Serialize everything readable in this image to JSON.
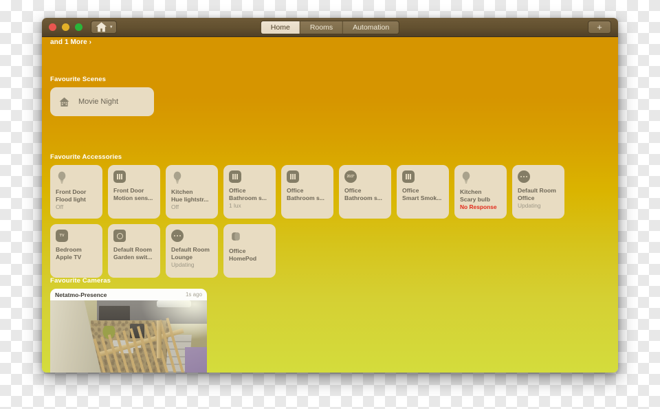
{
  "window": {
    "traffic_lights": [
      "close",
      "minimize",
      "zoom"
    ],
    "home_button_icon": "house-icon",
    "home_button_chevron": "▾",
    "add_button_label": "+"
  },
  "tabs": [
    {
      "label": "Home",
      "active": true
    },
    {
      "label": "Rooms",
      "active": false
    },
    {
      "label": "Automation",
      "active": false
    }
  ],
  "status_link": {
    "label": "and 1 More ›"
  },
  "sections": {
    "scenes": {
      "title": "Favourite Scenes",
      "cards": [
        {
          "icon": "house-icon",
          "label": "Movie Night"
        }
      ]
    },
    "accessories": {
      "title": "Favourite Accessories",
      "cards": [
        {
          "icon": "bulb-icon",
          "name_line1": "Front Door",
          "name_line2": "Flood light",
          "state": "Off",
          "state_kind": "normal"
        },
        {
          "icon": "sensor-icon",
          "name_line1": "Front Door",
          "name_line2": "Motion sens...",
          "state": "",
          "state_kind": "normal"
        },
        {
          "icon": "bulb-icon",
          "name_line1": "Kitchen",
          "name_line2": "Hue lightstr...",
          "state": "Off",
          "state_kind": "normal"
        },
        {
          "icon": "sensor-icon",
          "name_line1": "Office",
          "name_line2": "Bathroom s...",
          "state": "1 lux",
          "state_kind": "normal"
        },
        {
          "icon": "sensor-icon",
          "name_line1": "Office",
          "name_line2": "Bathroom s...",
          "state": "",
          "state_kind": "normal"
        },
        {
          "icon": "temp-icon",
          "name_line1": "Office",
          "name_line2": "Bathroom s...",
          "state": "",
          "state_kind": "normal",
          "icon_text": "20.5°"
        },
        {
          "icon": "sensor-icon",
          "name_line1": "Office",
          "name_line2": "Smart Smok...",
          "state": "",
          "state_kind": "normal"
        },
        {
          "icon": "bulb-icon",
          "name_line1": "Kitchen",
          "name_line2": "Scary bulb",
          "state": "No Response",
          "state_kind": "error"
        },
        {
          "icon": "dots-icon",
          "name_line1": "Default Room",
          "name_line2": "Office",
          "state": "Updating",
          "state_kind": "normal"
        },
        {
          "icon": "appletv-icon",
          "name_line1": "Bedroom",
          "name_line2": "Apple TV",
          "state": "",
          "state_kind": "normal",
          "icon_text": "TV"
        },
        {
          "icon": "outlet-icon",
          "name_line1": "Default Room",
          "name_line2": "Garden swit...",
          "state": "",
          "state_kind": "normal"
        },
        {
          "icon": "dots-icon",
          "name_line1": "Default Room",
          "name_line2": "Lounge",
          "state": "Updating",
          "state_kind": "normal"
        },
        {
          "icon": "homepod-icon",
          "name_line1": "Office",
          "name_line2": "HomePod",
          "state": "",
          "state_kind": "normal"
        }
      ]
    },
    "cameras": {
      "title": "Favourite Cameras",
      "cards": [
        {
          "name": "Netatmo-Presence",
          "time": "1s ago"
        }
      ]
    }
  },
  "colors": {
    "gradient_top": "#d69500",
    "gradient_bottom": "#d4dc3c",
    "card_bg": "#e8dcc2",
    "titlebar": "#62502f",
    "error": "#e22b1d",
    "muted": "#9d9786"
  }
}
